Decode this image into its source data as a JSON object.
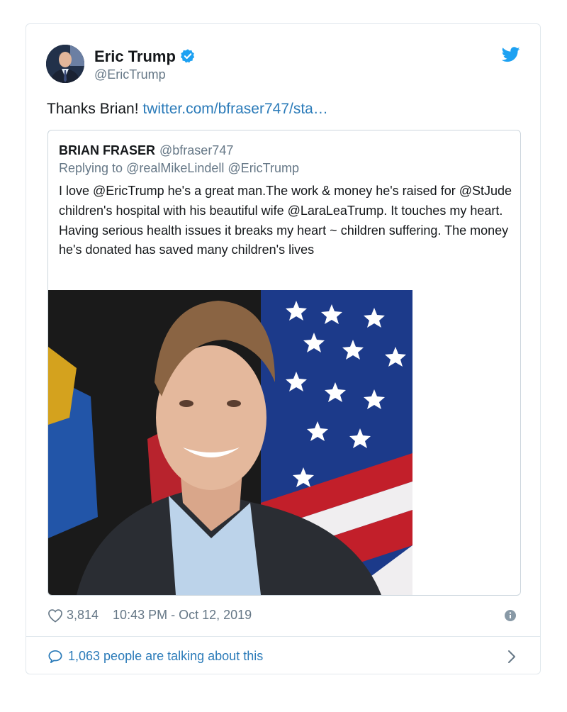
{
  "author": {
    "name": "Eric Trump",
    "handle": "@EricTrump",
    "verified": true
  },
  "tweet": {
    "text_prefix": "Thanks Brian! ",
    "link_text": "twitter.com/bfraser747/sta…"
  },
  "quoted_tweet": {
    "name": "BRIAN FRASER",
    "handle": "@bfraser747",
    "replying_to_label": "Replying to",
    "replying_to": "@realMikeLindell @EricTrump",
    "text": "I love @EricTrump he's a great man.The work & money he's raised for @StJude children's hospital with his beautiful wife @LaraLeaTrump. It touches my heart. Having serious health issues it breaks my heart ~ children suffering. The money he's donated has saved many children's lives"
  },
  "footer": {
    "likes": "3,814",
    "timestamp": "10:43 PM - Oct 12, 2019",
    "talking": "1,063 people are talking about this"
  },
  "icons": {
    "bird": "twitter-bird-icon",
    "verified": "verified-badge-icon",
    "heart": "heart-icon",
    "info": "info-icon",
    "comment": "comment-bubble-icon",
    "chevron": "chevron-right-icon"
  },
  "colors": {
    "twitter_blue": "#1da1f2",
    "link": "#2b7bb9",
    "muted": "#657786",
    "border": "#e1e8ed"
  }
}
